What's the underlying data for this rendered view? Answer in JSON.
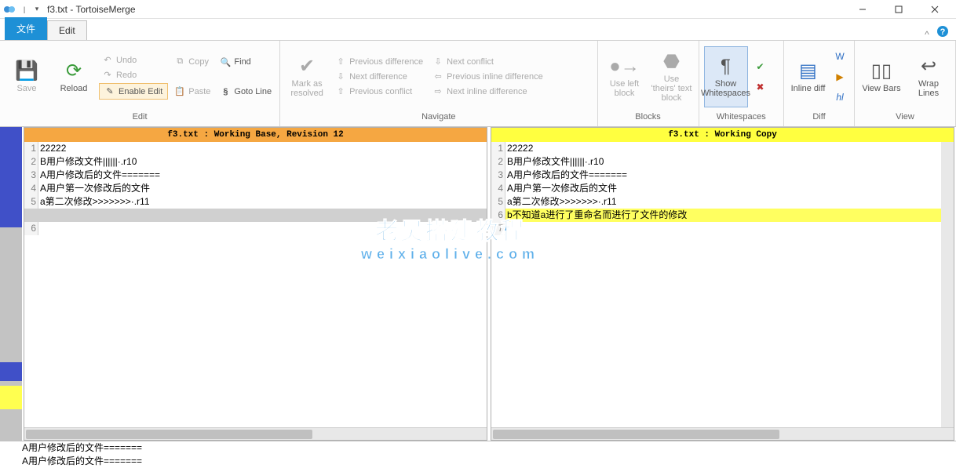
{
  "title": "f3.txt - TortoiseMerge",
  "tabs": {
    "file": "文件",
    "edit": "Edit"
  },
  "ribbon": {
    "save": "Save",
    "reload": "Reload",
    "undo": "Undo",
    "redo": "Redo",
    "enable_edit": "Enable Edit",
    "copy": "Copy",
    "paste": "Paste",
    "find": "Find",
    "goto_line": "Goto Line",
    "mark_resolved": "Mark as resolved",
    "prev_diff": "Previous difference",
    "next_diff": "Next difference",
    "prev_conflict": "Previous conflict",
    "next_conflict": "Next conflict",
    "prev_inline": "Previous inline difference",
    "next_inline": "Next inline difference",
    "use_left": "Use left block",
    "use_theirs": "Use 'theirs' text block",
    "show_ws": "Show Whitespaces",
    "inline_diff": "Inline diff",
    "view_bars": "View Bars",
    "wrap_lines": "Wrap Lines",
    "group_edit": "Edit",
    "group_nav": "Navigate",
    "group_blocks": "Blocks",
    "group_ws": "Whitespaces",
    "group_diff": "Diff",
    "group_view": "View"
  },
  "panes": {
    "left": {
      "title": "f3.txt : Working Base, Revision 12",
      "lines": [
        {
          "n": "1",
          "t": "22222"
        },
        {
          "n": "2",
          "t": "B用户修改文件||||||·.r10"
        },
        {
          "n": "3",
          "t": "A用户修改后的文件======="
        },
        {
          "n": "4",
          "t": "A用户第一次修改后的文件"
        },
        {
          "n": "5",
          "t": "a第二次修改>>>>>>>·.r11"
        },
        {
          "n": "",
          "t": "",
          "gap": true
        },
        {
          "n": "6",
          "t": ""
        }
      ]
    },
    "right": {
      "title": "f3.txt : Working Copy",
      "lines": [
        {
          "n": "1",
          "t": "22222"
        },
        {
          "n": "2",
          "t": "B用户修改文件||||||·.r10"
        },
        {
          "n": "3",
          "t": "A用户修改后的文件======="
        },
        {
          "n": "4",
          "t": "A用户第一次修改后的文件"
        },
        {
          "n": "5",
          "t": "a第二次修改>>>>>>>·.r11"
        },
        {
          "n": "6",
          "t": "b不知道a进行了重命名而进行了文件的修改",
          "added": true
        },
        {
          "n": "7",
          "t": ""
        }
      ]
    }
  },
  "bottom": [
    "A用户修改后的文件=======",
    "A用户修改后的文件======="
  ],
  "watermark": {
    "cn": "老吴搭建教程",
    "en": "weixiaolive.com"
  }
}
